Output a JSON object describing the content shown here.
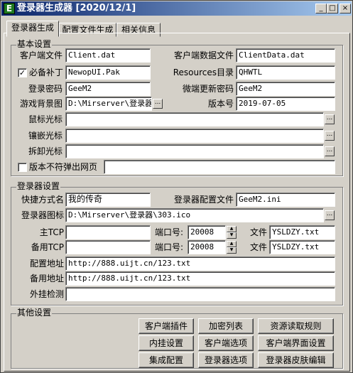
{
  "window": {
    "icon_glyph": "E",
    "title": "登录器生成器 [2020/12/1]",
    "min_glyph": "_",
    "max_glyph": "□",
    "close_glyph": "×"
  },
  "tabs": [
    {
      "label": "登录器生成"
    },
    {
      "label": "配置文件生成"
    },
    {
      "label": "相关信息"
    }
  ],
  "basic": {
    "group_label": "基本设置",
    "client_file_label": "客户端文件",
    "client_file_value": "Client.dat",
    "client_data_label": "客户端数据文件",
    "client_data_value": "ClientData.dat",
    "patch_checked": "✓",
    "patch_label": "必备补丁",
    "patch_value": "NewopUI.Pak",
    "resources_label": "Resources目录",
    "resources_value": "QHWTL",
    "password_label": "登录密码",
    "password_value": "GeeM2",
    "micro_pwd_label": "微端更新密码",
    "micro_pwd_value": "GeeM2",
    "bg_label": "游戏背景图",
    "bg_value": "D:\\Mirserver\\登录器\\",
    "version_label": "版本号",
    "version_value": "2019-07-05",
    "mouse_cursor_label": "鼠标光标",
    "mouse_cursor_value": "",
    "inlay_cursor_label": "镶嵌光标",
    "inlay_cursor_value": "",
    "remove_cursor_label": "拆卸光标",
    "remove_cursor_value": "",
    "popup_checked": "",
    "popup_label": "版本不符弹出网页",
    "popup_value": "",
    "browse_glyph": "..."
  },
  "launcher": {
    "group_label": "登录器设置",
    "shortcut_label": "快捷方式名",
    "shortcut_value": "我的传奇",
    "config_label": "登录器配置文件",
    "config_value": "GeeM2.ini",
    "icon_label": "登录器图标",
    "icon_value": "D:\\Mirserver\\登录器\\303.ico",
    "main_tcp_label": "主TCP",
    "main_tcp_value": "",
    "main_port_label": "端口号:",
    "main_port_value": "20008",
    "main_file_label": "文件",
    "main_file_value": "YSLDZY.txt",
    "backup_tcp_label": "备用TCP",
    "backup_tcp_value": "",
    "backup_port_label": "端口号:",
    "backup_port_value": "20008",
    "backup_file_label": "文件",
    "backup_file_value": "YSLDZY.txt",
    "config_url_label": "配置地址",
    "config_url_value": "http://888.uijt.cn/123.txt",
    "backup_url_label": "备用地址",
    "backup_url_value": "http://888.uijt.cn/123.txt",
    "plugin_detect_label": "外挂检测",
    "plugin_detect_value": "",
    "spin_up": "▲",
    "spin_down": "▼"
  },
  "other": {
    "group_label": "其他设置",
    "buttons": [
      {
        "label": "客户端插件"
      },
      {
        "label": "加密列表"
      },
      {
        "label": "资源读取规则"
      },
      {
        "label": "内挂设置"
      },
      {
        "label": "客户端选项"
      },
      {
        "label": "客户端界面设置"
      },
      {
        "label": "集成配置"
      },
      {
        "label": "登录器选项"
      },
      {
        "label": "登录器皮肤编辑"
      }
    ]
  }
}
